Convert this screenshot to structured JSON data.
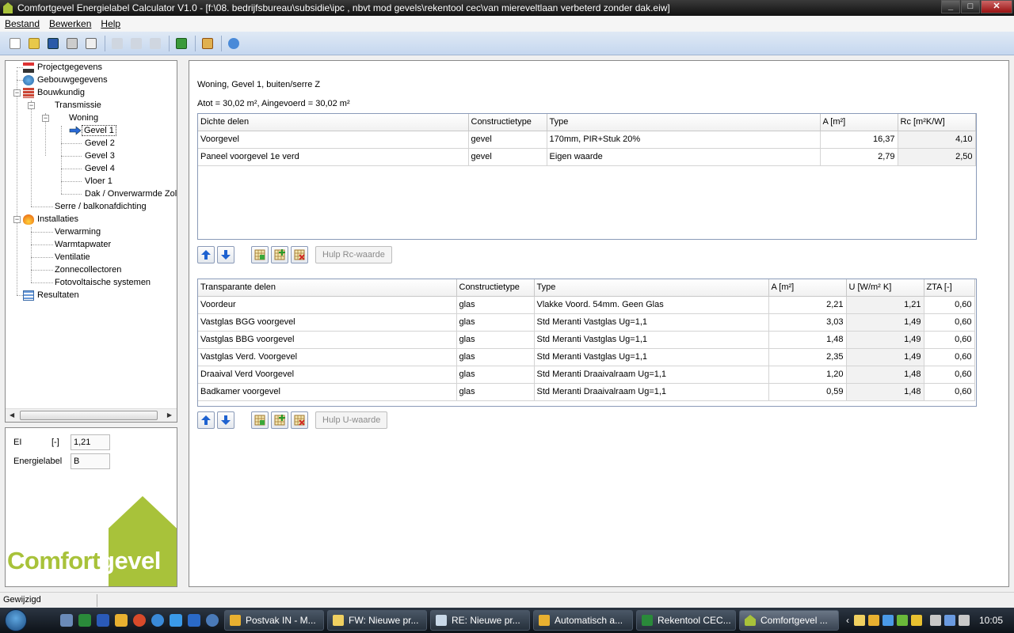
{
  "window": {
    "title": "Comfortgevel Energielabel Calculator V1.0 - [f:\\08. bedrijfsbureau\\subsidie\\ipc , nbvt mod gevels\\rekentool cec\\van miereveltlaan verbeterd zonder dak.eiw]"
  },
  "menu": [
    "Bestand",
    "Bewerken",
    "Help"
  ],
  "tree": {
    "projectgegevens": "Projectgegevens",
    "gebouwgegevens": "Gebouwgegevens",
    "bouwkundig": "Bouwkundig",
    "transmissie": "Transmissie",
    "woning": "Woning",
    "gevel1": "Gevel 1",
    "gevel2": "Gevel 2",
    "gevel3": "Gevel 3",
    "gevel4": "Gevel 4",
    "vloer1": "Vloer 1",
    "dak": "Dak / Onverwarmde Zol",
    "serre": "Serre / balkonafdichting",
    "installaties": "Installaties",
    "verwarming": "Verwarming",
    "warmtapwater": "Warmtapwater",
    "ventilatie": "Ventilatie",
    "zonnecollectoren": "Zonnecollectoren",
    "fotovoltaische": "Fotovoltaische systemen",
    "resultaten": "Resultaten"
  },
  "info": {
    "ei_label": "EI",
    "ei_unit": "[-]",
    "ei_value": "1,21",
    "energielabel_label": "Energielabel",
    "energielabel_value": "B"
  },
  "logo": {
    "part1": "Comfort",
    "part2": "gevel"
  },
  "content": {
    "heading": "Woning, Gevel 1, buiten/serre Z",
    "area_line": "Atot = 30,02 m², Aingevoerd = 30,02 m²"
  },
  "dichte": {
    "headers": [
      "Dichte delen",
      "Constructietype",
      "Type",
      "A [m²]",
      "Rc [m²K/W]"
    ],
    "rows": [
      [
        "Voorgevel",
        "gevel",
        "170mm, PIR+Stuk 20%",
        "16,37",
        "4,10"
      ],
      [
        "Paneel voorgevel 1e verd",
        "gevel",
        "Eigen waarde",
        "2,79",
        "2,50"
      ]
    ],
    "help_button": "Hulp Rc-waarde"
  },
  "transparante": {
    "headers": [
      "Transparante delen",
      "Constructietype",
      "Type",
      "A [m²]",
      "U [W/m² K]",
      "ZTA [-]"
    ],
    "rows": [
      [
        "Voordeur",
        "glas",
        "Vlakke Voord. 54mm. Geen Glas",
        "2,21",
        "1,21",
        "0,60"
      ],
      [
        "Vastglas BGG voorgevel",
        "glas",
        "Std Meranti Vastglas Ug=1,1",
        "3,03",
        "1,49",
        "0,60"
      ],
      [
        "Vastglas BBG voorgevel",
        "glas",
        "Std Meranti Vastglas Ug=1,1",
        "1,48",
        "1,49",
        "0,60"
      ],
      [
        "Vastglas Verd. Voorgevel",
        "glas",
        "Std Meranti Vastglas Ug=1,1",
        "2,35",
        "1,49",
        "0,60"
      ],
      [
        "Draaival Verd Voorgevel",
        "glas",
        "Std Meranti Draaivalraam Ug=1,1",
        "1,20",
        "1,48",
        "0,60"
      ],
      [
        "Badkamer voorgevel",
        "glas",
        "Std Meranti Draaivalraam Ug=1,1",
        "0,59",
        "1,48",
        "0,60"
      ]
    ],
    "help_button": "Hulp U-waarde"
  },
  "status": {
    "text": "Gewijzigd"
  },
  "taskbar": {
    "tasks": [
      "Postvak IN - M...",
      "FW: Nieuwe pr...",
      "RE: Nieuwe pr...",
      "Automatisch a...",
      "Rekentool CEC...",
      "Comfortgevel ..."
    ],
    "clock": "10:05"
  },
  "colors": {
    "brand_green": "#a8c23a",
    "grid_border": "#8a9ab8"
  }
}
